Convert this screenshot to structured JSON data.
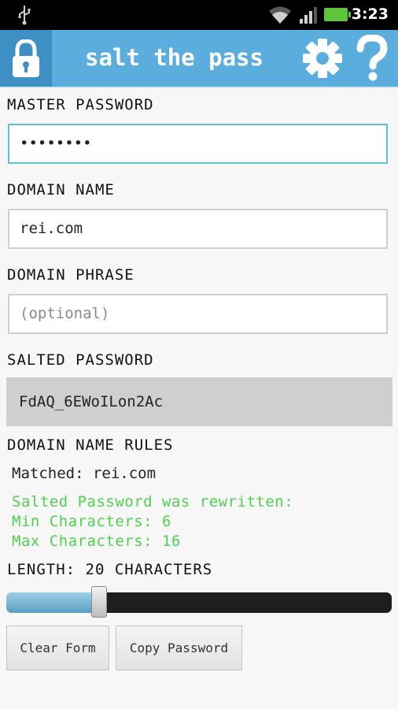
{
  "status_bar": {
    "time": "3:23",
    "icons": [
      "usb-icon",
      "wifi-icon",
      "signal-icon",
      "battery-icon"
    ],
    "battery_color": "#5ec63a"
  },
  "action_bar": {
    "title": "salt the pass",
    "background": "#5aaddc",
    "icons": [
      "lock-icon",
      "gear-icon",
      "help-icon"
    ]
  },
  "form": {
    "master_password": {
      "label": "MASTER PASSWORD",
      "value": "••••••••"
    },
    "domain_name": {
      "label": "DOMAIN NAME",
      "value": "rei.com"
    },
    "domain_phrase": {
      "label": "DOMAIN PHRASE",
      "placeholder": "(optional)",
      "value": ""
    },
    "salted_password": {
      "label": "SALTED PASSWORD",
      "value": "FdAQ_6EWoILon2Ac"
    }
  },
  "rules": {
    "label": "DOMAIN NAME RULES",
    "matched": "Matched: rei.com",
    "lines": [
      "Salted Password was rewritten:",
      "Min Characters: 6",
      "Max Characters: 16"
    ],
    "rule_color": "#4fd14f"
  },
  "length": {
    "label": "LENGTH: 20 CHARACTERS",
    "value": 20,
    "slider_fraction": 0.24
  },
  "buttons": {
    "clear": "Clear Form",
    "copy": "Copy Password"
  }
}
